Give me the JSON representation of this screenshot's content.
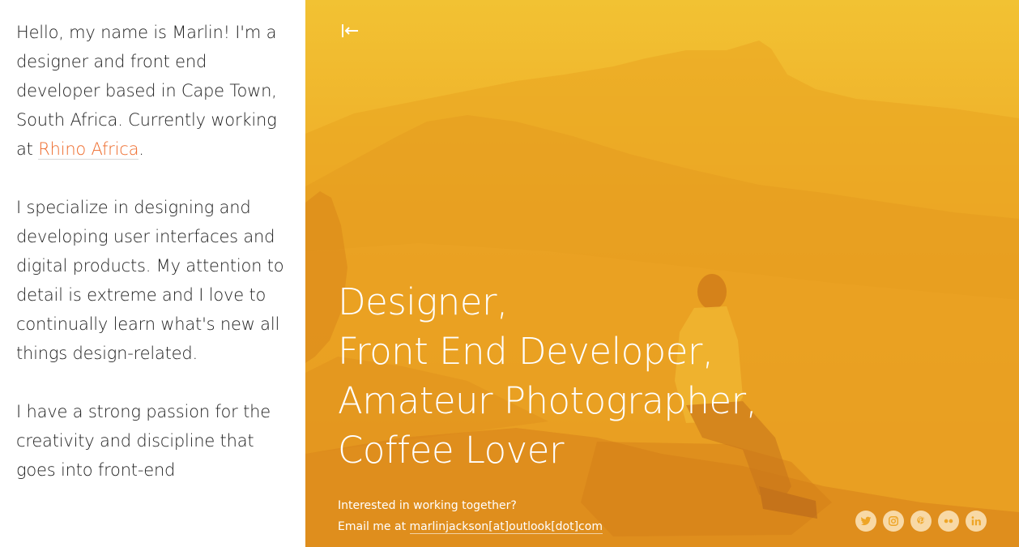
{
  "bio": {
    "p1_text": "Hello, my name is Marlin! I'm a designer and front end developer based in Cape Town, South Africa. Currently working at ",
    "p1_link": "Rhino Africa",
    "p1_end": ".",
    "p2": "I specialize in designing and developing user interfaces and digital products. My attention to detail is extreme and I love to continually learn what's new all things design-related.",
    "p3": "I have a strong passion for the creativity and discipline that goes into front-end"
  },
  "hero": {
    "headline": [
      "Designer,",
      "Front End Developer,",
      "Amateur Photographer,",
      "Coffee Lover"
    ],
    "contact_line1": "Interested in working together?",
    "contact_prefix": "Email me at ",
    "contact_email": "marlinjackson[at]outlook[dot]com",
    "overlay_color": "#f0b52c",
    "icons": {
      "collapse": "collapse-left-icon",
      "socials": [
        "twitter-icon",
        "instagram-icon",
        "pinterest-icon",
        "flickr-icon",
        "linkedin-icon"
      ]
    }
  },
  "colors": {
    "accent_link": "#ee6a2a",
    "body_text": "#222222",
    "hero_text": "#ffffff"
  }
}
